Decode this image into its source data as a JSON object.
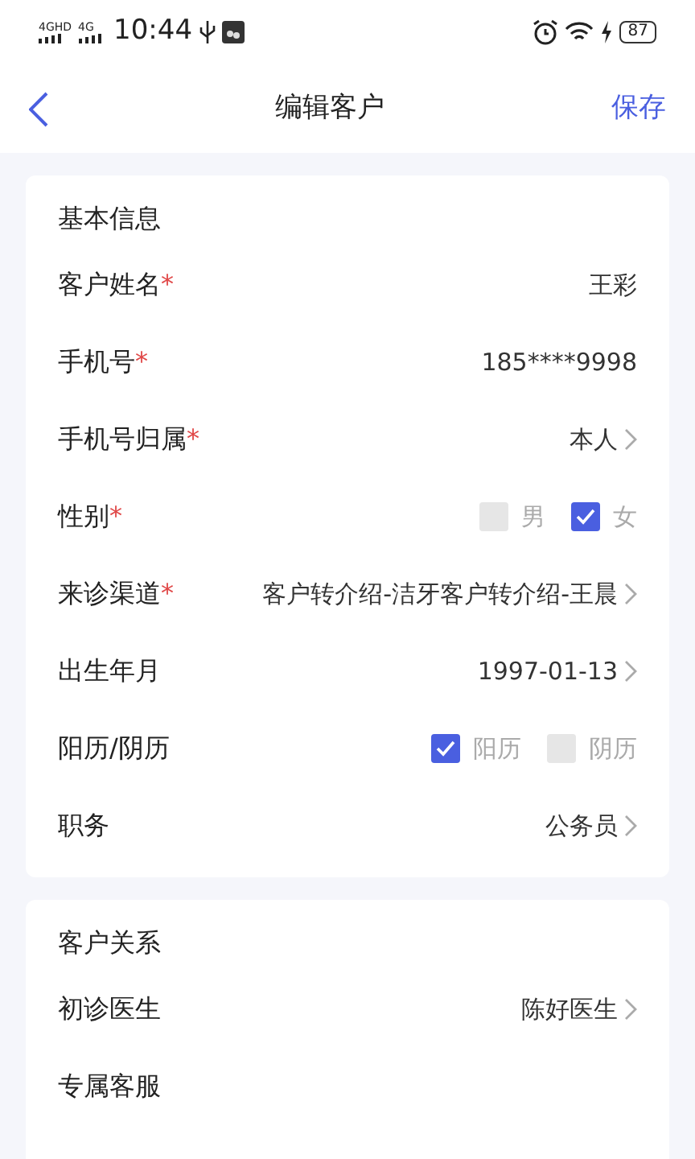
{
  "status_bar": {
    "network_1": "4GHD",
    "network_2": "4G",
    "time": "10:44",
    "battery": "87"
  },
  "header": {
    "title": "编辑客户",
    "action": "保存"
  },
  "sections": [
    {
      "title": "基本信息",
      "rows": [
        {
          "kind": "text",
          "label": "客户姓名",
          "required_mark": "*",
          "value": "王彩"
        },
        {
          "kind": "text",
          "label": "手机号",
          "required_mark": "*",
          "value": "185****9998"
        },
        {
          "kind": "select",
          "label": "手机号归属",
          "required_mark": "*",
          "value": "本人"
        },
        {
          "kind": "checks",
          "label": "性别",
          "required_mark": "*",
          "options": [
            {
              "label": "男",
              "checked": false
            },
            {
              "label": "女",
              "checked": true
            }
          ]
        },
        {
          "kind": "select",
          "label": "来诊渠道",
          "required_mark": "*",
          "value": "客户转介绍-洁牙客户转介绍-王晨"
        },
        {
          "kind": "select",
          "label": "出生年月",
          "value": "1997-01-13"
        },
        {
          "kind": "checks",
          "label": "阳历/阴历",
          "options": [
            {
              "label": "阳历",
              "checked": true
            },
            {
              "label": "阴历",
              "checked": false
            }
          ]
        },
        {
          "kind": "select",
          "label": "职务",
          "value": "公务员"
        }
      ]
    },
    {
      "title": "客户关系",
      "rows": [
        {
          "kind": "select",
          "label": "初诊医生",
          "value": "陈好医生"
        },
        {
          "kind": "text",
          "label": "专属客服"
        }
      ]
    }
  ]
}
